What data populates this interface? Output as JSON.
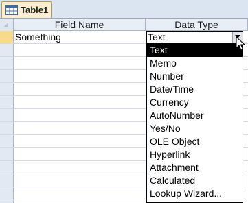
{
  "tab": {
    "label": "Table1",
    "icon": "table-icon"
  },
  "grid": {
    "headers": {
      "field_name": "Field Name",
      "data_type": "Data Type"
    },
    "active_row": {
      "field_name": "Something",
      "data_type": "Text"
    }
  },
  "dropdown": {
    "selected": "Text",
    "options": [
      "Text",
      "Memo",
      "Number",
      "Date/Time",
      "Currency",
      "AutoNumber",
      "Yes/No",
      "OLE Object",
      "Hyperlink",
      "Attachment",
      "Calculated",
      "Lookup Wizard..."
    ]
  },
  "colors": {
    "tab_bg": "#fbeed0",
    "header_bg": "#e8eef6",
    "active_selector": "#f9d98a",
    "selection": "#000000"
  }
}
